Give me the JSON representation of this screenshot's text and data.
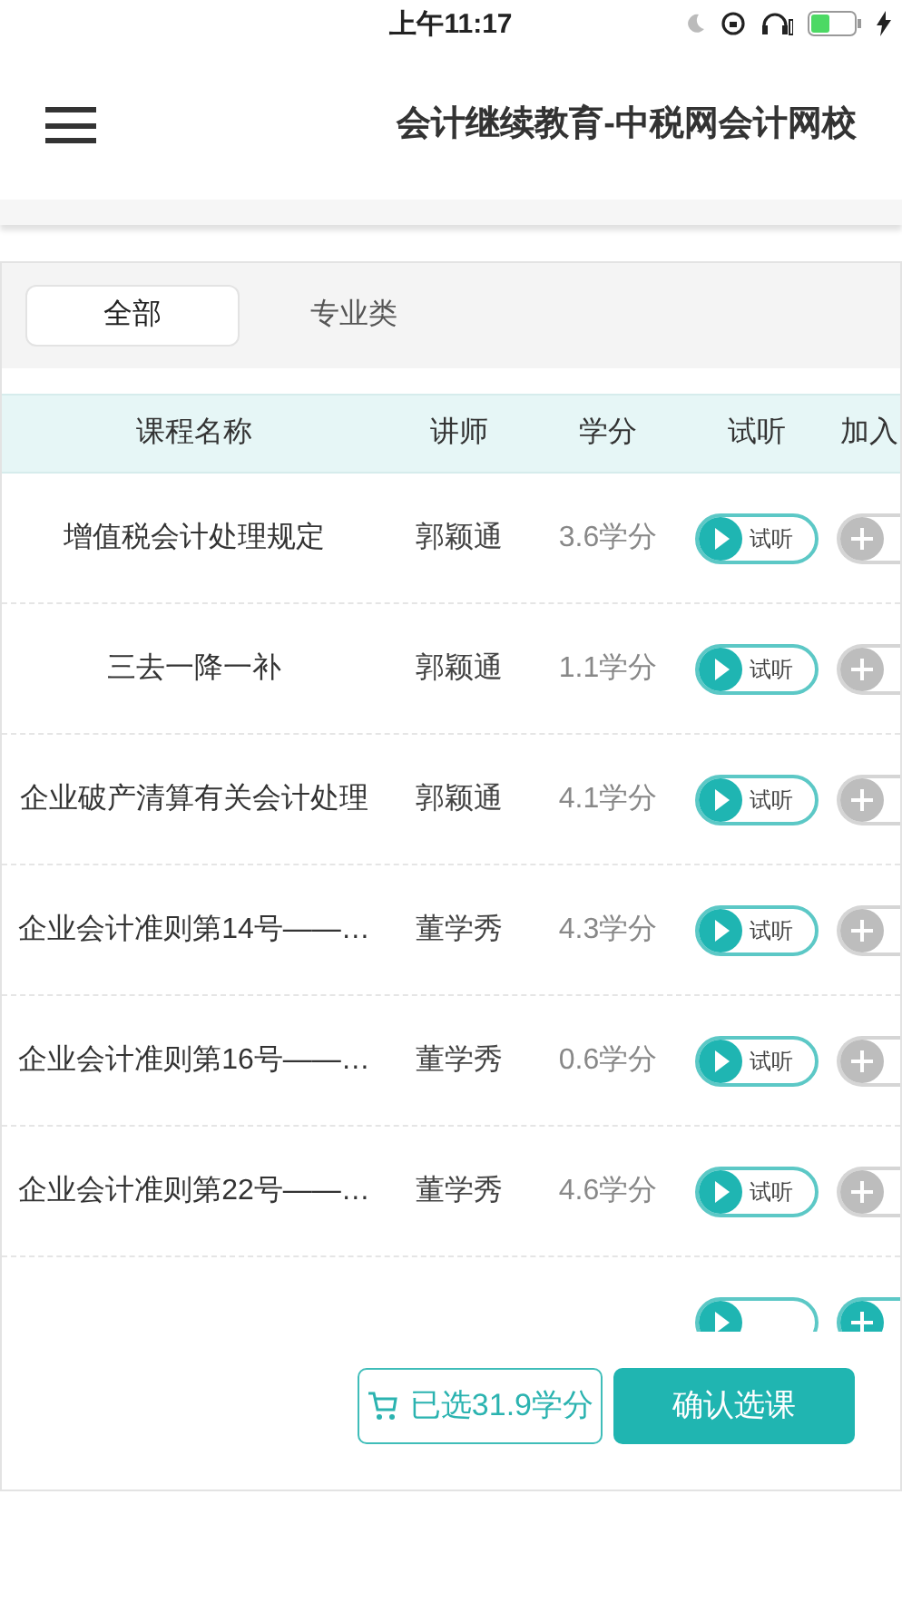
{
  "status_bar": {
    "time": "上午11:17"
  },
  "header": {
    "title": "会计继续教育-中税网会计网校"
  },
  "tabs": [
    {
      "label": "全部",
      "selected": true
    },
    {
      "label": "专业类",
      "selected": false
    }
  ],
  "table": {
    "columns": [
      "课程名称",
      "讲师",
      "学分",
      "试听",
      "加入"
    ],
    "rows": [
      {
        "name": "增值税会计处理规定",
        "teacher": "郭颖通",
        "credit": "3.6学分",
        "listen": "试听",
        "added": false
      },
      {
        "name": "三去一降一补",
        "teacher": "郭颖通",
        "credit": "1.1学分",
        "listen": "试听",
        "added": false
      },
      {
        "name": "企业破产清算有关会计处理",
        "teacher": "郭颖通",
        "credit": "4.1学分",
        "listen": "试听",
        "added": false
      },
      {
        "name": "企业会计准则第14号——…",
        "teacher": "董学秀",
        "credit": "4.3学分",
        "listen": "试听",
        "added": false
      },
      {
        "name": "企业会计准则第16号——…",
        "teacher": "董学秀",
        "credit": "0.6学分",
        "listen": "试听",
        "added": false
      },
      {
        "name": "企业会计准则第22号——…",
        "teacher": "董学秀",
        "credit": "4.6学分",
        "listen": "试听",
        "added": false
      },
      {
        "added": true
      }
    ]
  },
  "footer": {
    "selected_credits": "已选31.9学分",
    "confirm": "确认选课"
  }
}
